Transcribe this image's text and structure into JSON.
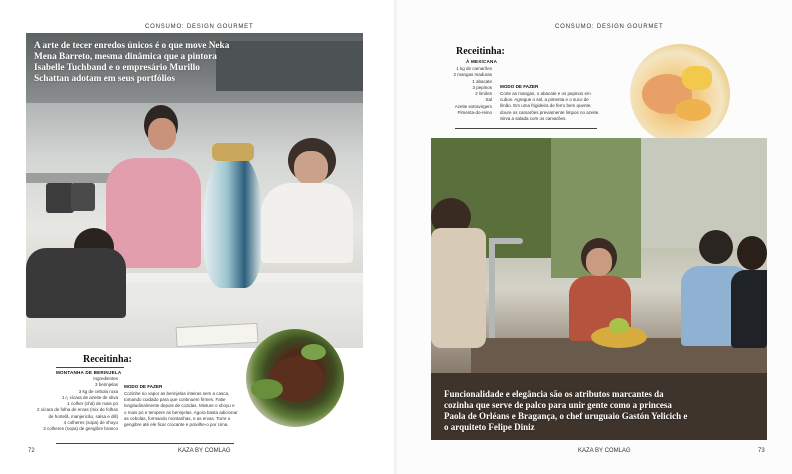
{
  "spread": {
    "header_left": "CONSUMO: DESIGN GOURMET",
    "header_right": "CONSUMO: DESIGN GOURMET",
    "folio_left": "72",
    "folio_right": "73",
    "footer_brand_left": "KAZA BY COMLAG",
    "footer_brand_right": "KAZA BY COMLAG"
  },
  "left": {
    "photo_caption": "A arte de tecer enredos únicos é o que move Neka Mena Barreto, mesma dinâmica que a pintora Isabelle Tuchband e o empresário Murillo Schattan adotam em seus portfólios",
    "recipe": {
      "title": "Receitinha:",
      "name": "MONTANHA DE BERINJELA",
      "ingredients_label": "Ingredientes",
      "ingredients": [
        "3 berinjelas",
        "3 kg de cebola roxa",
        "1 ⁄₂ xícara de azeite de oliva",
        "1 colher (chá) de mais pó",
        "2 xícara de folha de ervas (mix de folhas",
        "de hortelã, manjericão, salsa e dill)",
        "4 colheres (sopa) de shoyu",
        "3 colheres (sopa) de gengibre branco"
      ],
      "method_title": "MODO DE FAZER",
      "method": "Cozinhe no vapor as berinjelas inteiras sem a casca, tomando cuidado para que continuem firmes. Fatie longitudinalmente depois de cozidas. Misture o shoyu e o mais pó e tempere as berinjelas. Agora basta adicionar as cebolas, formando montanhas, e as ervas. Torre o gengibre até ele ficar crocante e polvilhe-o por cima."
    }
  },
  "right": {
    "recipe": {
      "title": "Receitinha:",
      "name": "À MEXICANA",
      "ingredients": [
        "1 kg de camarões",
        "2 mangas maduras",
        "1 abacate",
        "3 pepinos",
        "2 limões",
        "Sal",
        "Azeite extravirgem",
        "Pimenta-do-reino"
      ],
      "method_title": "MODO DE FAZER",
      "method": "Corte as mangas, o abacate e os pepinos em cubos. Agregue o sal, a pimenta e o suco de limão. Em uma frigideira de ferro bem quente, doure os camarões previamente limpos no azeite. Sirva a salada com os camarões."
    },
    "photo_caption": "Funcionalidade e elegância são os atributos marcantes da cozinha que serve de palco para unir gente como a princesa Paola de Orléans e Bragança, o chef uruguaio Gastón Yelicich e o arquiteto Felipe Diniz"
  },
  "palette": {
    "text": "#222222",
    "rule": "#444444",
    "caption_text": "#ffffff"
  }
}
